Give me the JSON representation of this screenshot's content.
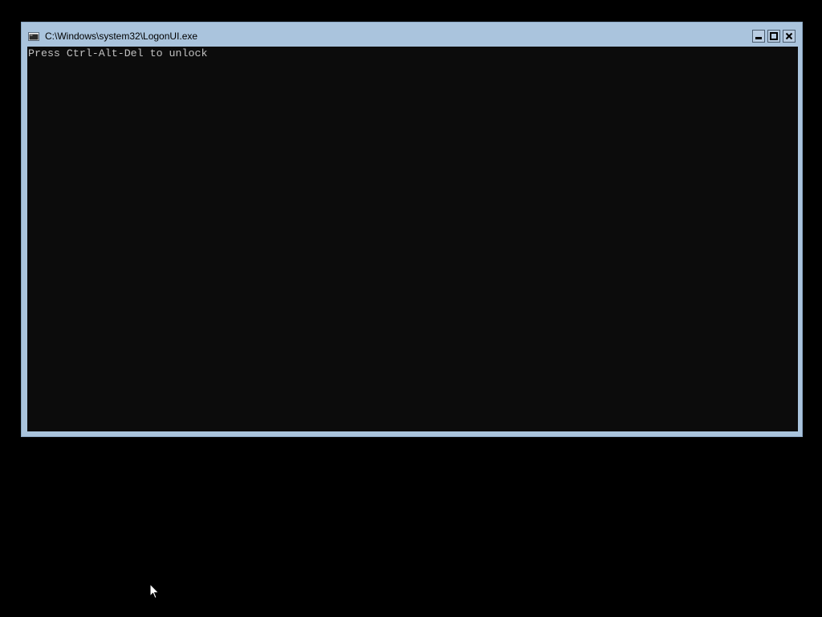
{
  "window": {
    "title": "C:\\Windows\\system32\\LogonUI.exe",
    "icon": "console-window-icon",
    "controls": {
      "minimize": "minimize-icon",
      "maximize": "maximize-icon",
      "close": "close-icon"
    }
  },
  "console": {
    "lines": [
      "Press Ctrl-Alt-Del to unlock"
    ]
  },
  "colors": {
    "desktop_background": "#000000",
    "window_frame": "#aac4dd",
    "console_background": "#0c0c0c",
    "console_text": "#c0c0c0"
  },
  "pointer": "arrow-cursor-icon"
}
